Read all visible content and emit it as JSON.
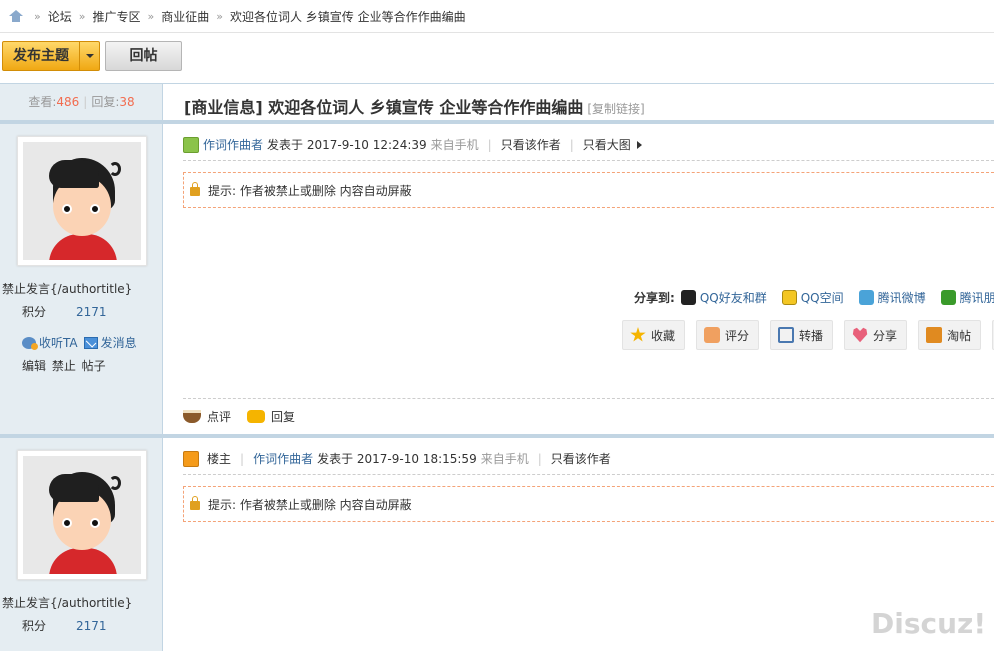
{
  "breadcrumb": {
    "items": [
      "论坛",
      "推广专区",
      "商业征曲",
      "欢迎各位词人 乡镇宣传 企业等合作作曲编曲"
    ]
  },
  "toolbar": {
    "post_label": "发布主题",
    "reply_label": "回帖"
  },
  "stats": {
    "views_label": "查看:",
    "views": "486",
    "replies_label": "回复:",
    "replies": "38"
  },
  "thread": {
    "title": "[商业信息] 欢迎各位词人 乡镇宣传 企业等合作作曲编曲",
    "copy_link": "[复制链接]"
  },
  "posts": [
    {
      "author": "作词作曲者",
      "posted_at": "发表于 2017-9-10 12:24:39",
      "source": "来自手机",
      "only_author": "只看该作者",
      "big_image": "只看大图",
      "notice": "提示: 作者被禁止或删除 内容自动屏蔽",
      "user_title": "禁止发言{/authortitle}",
      "score_label": "积分",
      "score": "2171",
      "follow": "收听TA",
      "message": "发消息",
      "admin_links": "编辑 禁止 帖子"
    },
    {
      "floor": "楼主",
      "author": "作词作曲者",
      "posted_at": "发表于 2017-9-10 18:15:59",
      "source": "来自手机",
      "only_author": "只看该作者",
      "notice": "提示: 作者被禁止或删除 内容自动屏蔽",
      "user_title": "禁止发言{/authortitle}",
      "score_label": "积分",
      "score": "2171"
    }
  ],
  "share": {
    "label": "分享到:",
    "items": [
      {
        "label": "QQ好友和群",
        "icon": "qq-icon"
      },
      {
        "label": "QQ空间",
        "icon": "qzone-icon"
      },
      {
        "label": "腾讯微博",
        "icon": "tencent-weibo-icon"
      },
      {
        "label": "腾讯朋",
        "icon": "clover-icon"
      }
    ]
  },
  "actions": [
    "收藏",
    "评分",
    "转播",
    "分享",
    "淘帖"
  ],
  "post_footer": {
    "comment": "点评",
    "reply": "回复"
  },
  "watermark": "Discuz!",
  "colors": {
    "link": "#336699",
    "accent_button": "#f0a813",
    "sidebar_bg": "#e5edf2",
    "count": "#f26c4f"
  }
}
